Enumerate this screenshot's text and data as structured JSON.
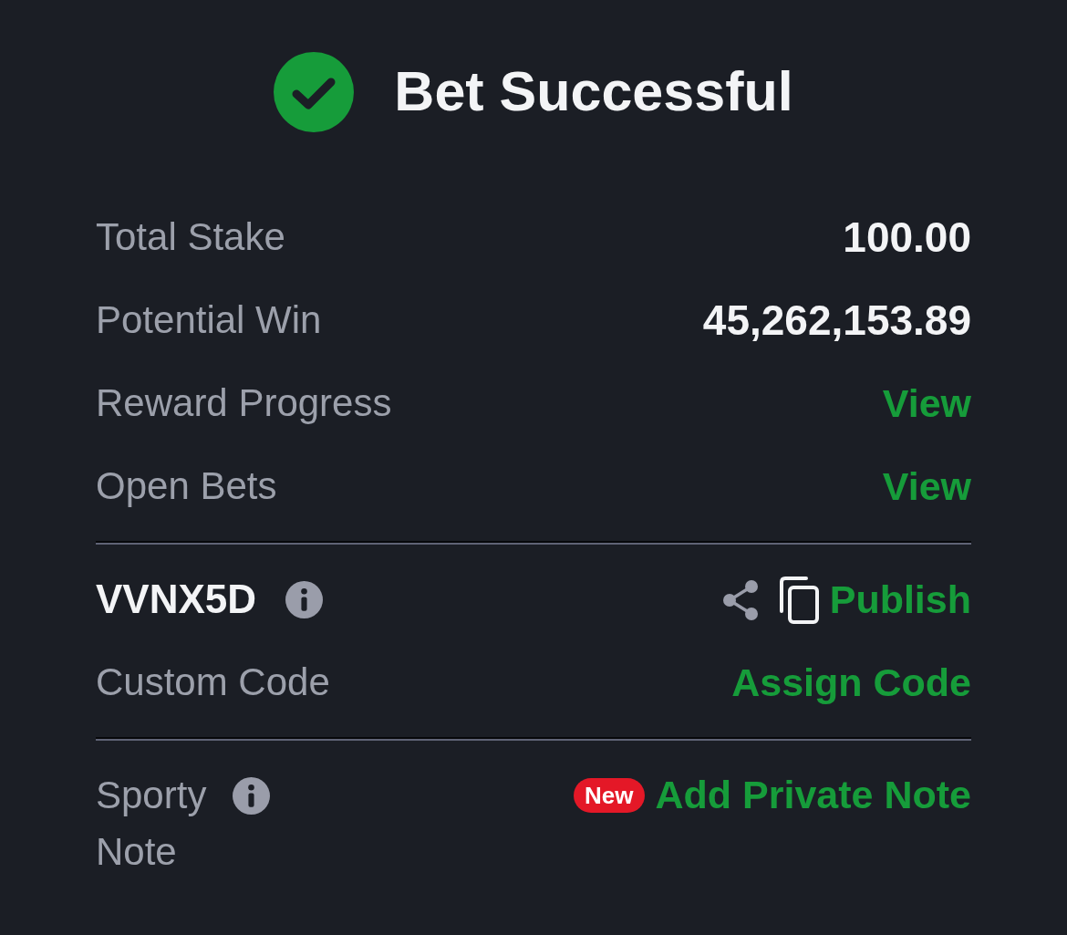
{
  "header": {
    "title": "Bet Successful"
  },
  "summary_rows": [
    {
      "label": "Total Stake",
      "value": "100.00",
      "kind": "value"
    },
    {
      "label": "Potential Win",
      "value": "45,262,153.89",
      "kind": "value"
    },
    {
      "label": "Reward Progress",
      "value": "View",
      "kind": "link"
    },
    {
      "label": "Open Bets",
      "value": "View",
      "kind": "link"
    }
  ],
  "booking": {
    "code": "VVNX5D",
    "action": "Publish"
  },
  "custom_code": {
    "label": "Custom Code",
    "action": "Assign Code"
  },
  "note": {
    "label": "Sporty Note",
    "badge": "New",
    "action": "Add Private Note"
  }
}
